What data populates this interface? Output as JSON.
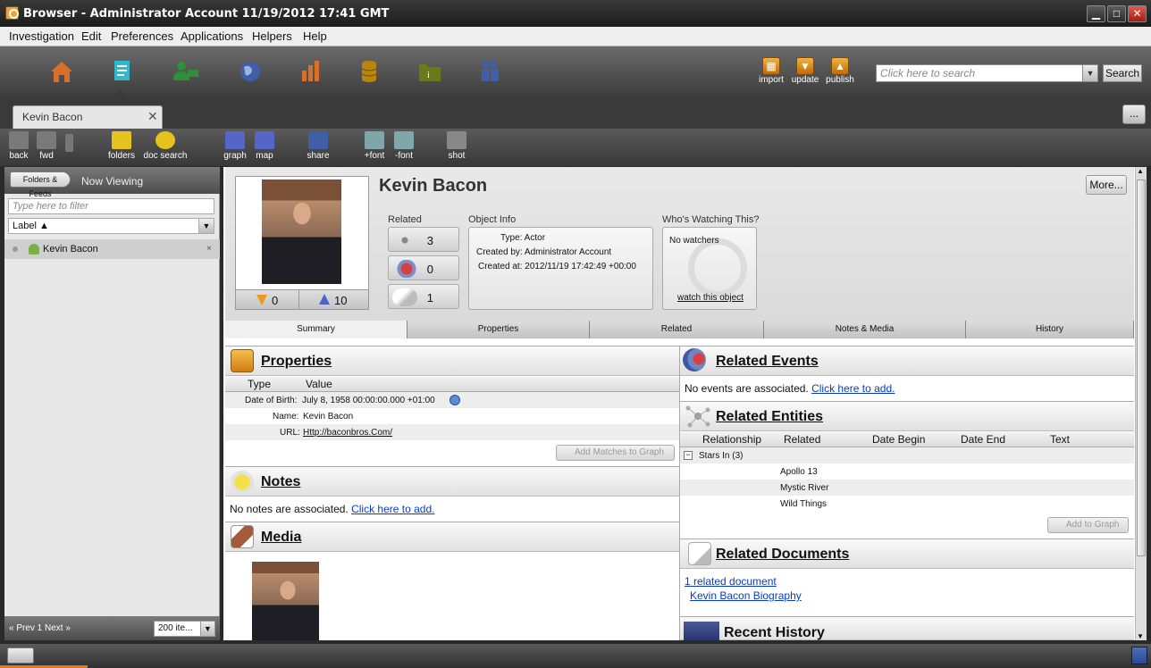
{
  "window": {
    "title": "Browser - Administrator Account 11/19/2012 17:41 GMT"
  },
  "menu": [
    "Investigation",
    "Edit",
    "Preferences",
    "Applications",
    "Helpers",
    "Help"
  ],
  "main_toolbar": {
    "nav_icons": [
      "home-icon",
      "document-icon",
      "user-icon",
      "globe-icon",
      "bar-chart-icon",
      "database-icon",
      "folder-icon",
      "people-icon"
    ],
    "actions": [
      "import",
      "update",
      "publish"
    ],
    "search_placeholder": "Click here to search",
    "search_button": "Search"
  },
  "tab": {
    "label": "Kevin Bacon",
    "close": "✕",
    "more": "..."
  },
  "sub_toolbar": [
    "back",
    "fwd",
    "folders",
    "doc search",
    "graph",
    "map",
    "share",
    "+font",
    "-font",
    "shot"
  ],
  "sidebar": {
    "folders_button": "Folders & Feeds",
    "now_viewing": "Now Viewing",
    "filter_placeholder": "Type here to filter",
    "sort_label": "Label ▲",
    "item": "Kevin Bacon",
    "item_close": "×",
    "pager": "« Prev  1  Next »",
    "items_per_page": "200 ite..."
  },
  "header": {
    "title": "Kevin Bacon",
    "more_button": "More...",
    "votes_down": "0",
    "votes_up": "10",
    "related_label": "Related",
    "related_counts": [
      "3",
      "0",
      "1"
    ],
    "object_info_label": "Object Info",
    "type": "Type: Actor",
    "created_by": "Created by: Administrator Account",
    "created_at": "Created at: 2012/11/19 17:42:49 +00:00",
    "watching_label": "Who's Watching This?",
    "no_watchers": "No watchers",
    "watch_link": "watch this object"
  },
  "tabs": [
    "Summary",
    "Properties",
    "Related",
    "Notes & Media",
    "History"
  ],
  "properties": {
    "title": "Properties",
    "col_type": "Type",
    "col_value": "Value",
    "rows": [
      {
        "key": "Date of Birth:",
        "value": "July 8, 1958 00:00:00.000 +01:00"
      },
      {
        "key": "Name:",
        "value": "Kevin Bacon"
      },
      {
        "key": "URL:",
        "value": "Http://baconbros.Com/"
      }
    ],
    "add_button": "Add Matches to Graph"
  },
  "notes": {
    "title": "Notes",
    "text": "No notes are associated.",
    "link": "Click here to add."
  },
  "media": {
    "title": "Media"
  },
  "related_events": {
    "title": "Related Events",
    "text": "No events are associated.",
    "link": "Click here to add."
  },
  "related_entities": {
    "title": "Related Entities",
    "columns": [
      "Relationship",
      "Related",
      "Date Begin",
      "Date End",
      "Text"
    ],
    "group": "Stars In (3)",
    "group_toggle": "−",
    "items": [
      "Apollo 13",
      "Mystic River",
      "Wild Things"
    ],
    "add_button": "Add to Graph"
  },
  "related_documents": {
    "title": "Related Documents",
    "count_link": "1 related document",
    "doc_link": "Kevin Bacon Biography"
  },
  "recent_history": {
    "title": "Recent History"
  },
  "colors": {
    "accent_orange": "#e89a1c",
    "link_blue": "#0a3acc",
    "nav_teal": "#35b7c9"
  }
}
